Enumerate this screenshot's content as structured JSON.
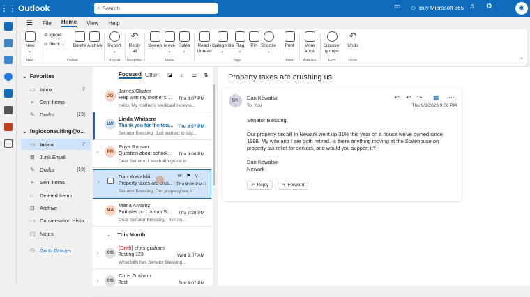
{
  "app": {
    "title": "Outlook",
    "search_placeholder": "Search",
    "buy_label": "Buy Microsoft 365"
  },
  "menu": {
    "file": "File",
    "home": "Home",
    "view": "View",
    "help": "Help"
  },
  "ribbon": {
    "new": "New",
    "ignore": "Ignore",
    "block": "Block",
    "delete": "Delete",
    "archive": "Archive",
    "report": "Report",
    "reply_all": "Reply\nall",
    "sweep": "Sweep",
    "move": "Move",
    "rules": "Rules",
    "read_unread": "Read /\nUnread",
    "categorize": "Categorize",
    "flag": "Flag",
    "pin": "Pin",
    "snooze": "Snooze",
    "print": "Print",
    "more_apps": "More\napps",
    "discover_groups": "Discover\ngroups",
    "undo": "Undo",
    "groups": {
      "new": "New",
      "delete": "Delete",
      "report": "Report",
      "respond": "Respond",
      "move": "Move",
      "tags": "Tags",
      "print": "Print",
      "addins": "Add-ins",
      "find": "Find",
      "undo": "Undo"
    }
  },
  "folders": {
    "favorites_label": "Favorites",
    "favorites": [
      {
        "name": "Inbox",
        "count": "7"
      },
      {
        "name": "Sent Items",
        "count": ""
      },
      {
        "name": "Drafts",
        "count": "[19]"
      }
    ],
    "account_label": "fugioconsulting@o...",
    "account": [
      {
        "name": "Inbox",
        "count": "7"
      },
      {
        "name": "Junk Email",
        "count": ""
      },
      {
        "name": "Drafts",
        "count": "[19]"
      },
      {
        "name": "Sent Items",
        "count": ""
      },
      {
        "name": "Deleted Items",
        "count": ""
      },
      {
        "name": "Archive",
        "count": ""
      },
      {
        "name": "Conversation Histo...",
        "count": ""
      },
      {
        "name": "Notes",
        "count": ""
      }
    ],
    "go_to_groups": "Go to Groups"
  },
  "list": {
    "focused": "Focused",
    "other": "Other",
    "section_this_month": "This Month",
    "messages": [
      {
        "initials": "JO",
        "from": "James Okafor",
        "subject": "Help with my mother's ...",
        "time": "Thu 9:07 PM",
        "preview": "Hello, My mother's Medicaid renewa...",
        "color": "#f6d5c4",
        "fg": "#8a3707"
      },
      {
        "initials": "LW",
        "from": "Linda Whitacre",
        "subject": "Thank you for the tow...",
        "time": "Thu 9:07 PM",
        "preview": "Senator Blessing, Just wanted to say...",
        "color": "#d7e7f7",
        "fg": "#0f548c"
      },
      {
        "initials": "PR",
        "from": "Priya Raman",
        "subject": "Question about school...",
        "time": "Thu 9:06 PM",
        "preview": "Dear Senator, I teach 4th grade in ...",
        "color": "#f6d5c4",
        "fg": "#8a3707"
      },
      {
        "initials": "DK",
        "from": "Dan Kowalski",
        "subject": "Property taxes are crus...",
        "time": "Thu 9:06 PM",
        "preview": "Senator Blessing, Our property tax b...",
        "color": "#e0e0e0",
        "fg": "#424242"
      },
      {
        "initials": "MA",
        "from": "Maria Alvarez",
        "subject": "Potholes on Loudon St...",
        "time": "Thu 7:28 PM",
        "preview": "Dear Senator Blessing, I live on...",
        "color": "#f6d5c4",
        "fg": "#8a3707"
      },
      {
        "initials": "CG",
        "draft": "[Draft]",
        "from": "chris graham",
        "subject": "Testing 123",
        "time": "Wed 9:07 AM",
        "preview": "What bills has Senator Blessing...",
        "color": "#e0e0e0",
        "fg": "#424242"
      },
      {
        "initials": "CG",
        "from": "Chris Graham",
        "subject": "Test",
        "time": "Tue 8:07 PM",
        "preview": "",
        "color": "#e0e0e0",
        "fg": "#424242"
      }
    ]
  },
  "reading": {
    "subject": "Property taxes are crushing us",
    "initials": "DK",
    "from": "Dan Kowalski",
    "to": "To: You",
    "date": "Thu 9/3/2026 9:06 PM",
    "greeting": "Senator Blessing,",
    "body": "Our property tax bill in Newark went up 31% this year on a house we've owned since 1998. My wife and I are both retired. Is there anything moving at the Statehouse on property tax relief for seniors, and would you support it?",
    "sig_name": "Dan Kowalski",
    "sig_city": "Newark",
    "reply": "Reply",
    "forward": "Forward"
  }
}
